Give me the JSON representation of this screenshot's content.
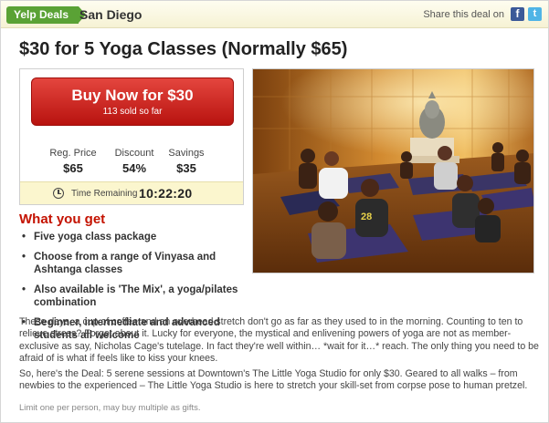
{
  "header": {
    "tag": "Yelp Deals",
    "city": "San Diego",
    "share_text": "Share this deal on",
    "facebook_glyph": "f",
    "twitter_glyph": "t"
  },
  "deal": {
    "title": "$30 for 5 Yoga Classes (Normally $65)"
  },
  "buy": {
    "label": "Buy Now for $30",
    "sold": "113 sold so far"
  },
  "stats": [
    {
      "label": "Reg. Price",
      "value": "$65"
    },
    {
      "label": "Discount",
      "value": "54%"
    },
    {
      "label": "Savings",
      "value": "$35"
    }
  ],
  "timer": {
    "label": "Time Remaining",
    "value": "10:22:20"
  },
  "what_you_get": {
    "heading": "What you get",
    "items": [
      "Five yoga class package",
      "Choose from a range of Vinyasa and Ashtanga classes",
      "Also available is 'The Mix', a yoga/pilates combination",
      "Beginner, intermediate and advanced students all welcome"
    ]
  },
  "description": [
    "These days, a cup of coffee and an overhead stretch don't go as far as they used to in the morning. Counting to ten to relieve stress? Forget about it. Lucky for everyone, the mystical and enlivening powers of yoga are not as member-exclusive as say, Nicholas Cage's tutelage. In fact they're well within… *wait for it…* reach. The only thing you need to be afraid of is what if feels like to kiss your knees.",
    "So, here's the Deal: 5 serene sessions at Downtown's The Little Yoga Studio for only $30. Geared to all walks – from newbies to the experienced –  The Little Yoga Studio is here to stretch your skill-set from corpse pose to human pretzel."
  ],
  "fine_print": "Limit one per person, may buy multiple as gifts.",
  "photo": {
    "shirt_number": "28"
  },
  "colors": {
    "accent_green": "#5aa235",
    "buy_red": "#c8201a",
    "heading_red": "#c41200",
    "timer_bg": "#fbf6ce"
  },
  "icons": {
    "clock": "clock-icon",
    "facebook": "facebook-icon",
    "twitter": "twitter-icon"
  }
}
